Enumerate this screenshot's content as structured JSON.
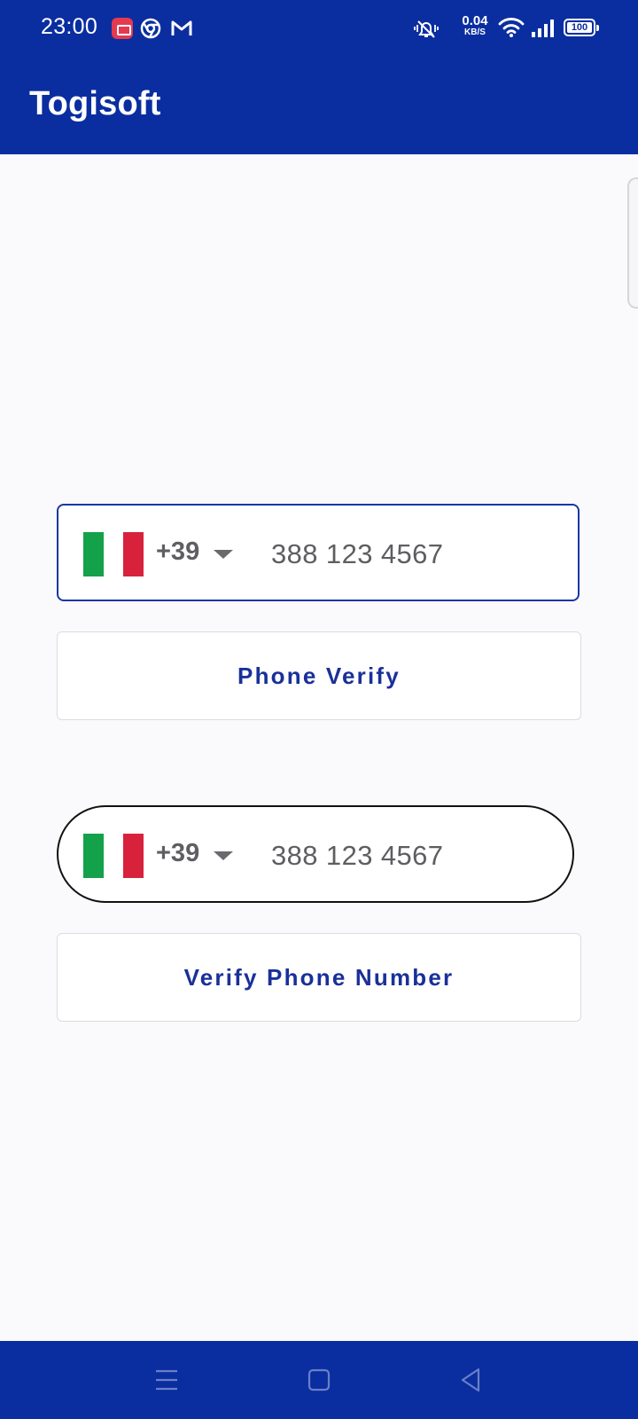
{
  "status_bar": {
    "time": "23:00",
    "net_speed_value": "0.04",
    "net_speed_unit": "KB/S",
    "battery": "100",
    "icons": [
      "screen-record-icon",
      "chrome-icon",
      "gmail-icon",
      "mute-icon",
      "wifi-icon",
      "signal-icon",
      "battery-icon"
    ]
  },
  "app_bar": {
    "title": "Togisoft"
  },
  "phone_input_1": {
    "country_flag": "italy-flag-icon",
    "dial_code": "+39",
    "placeholder": "388 123 4567",
    "value": ""
  },
  "button_1": {
    "label": "Phone Verify"
  },
  "phone_input_2": {
    "country_flag": "italy-flag-icon",
    "dial_code": "+39",
    "placeholder": "388 123 4567",
    "value": ""
  },
  "button_2": {
    "label": "Verify Phone Number"
  },
  "nav_bar": {
    "buttons": [
      "menu-icon",
      "home-icon",
      "back-icon"
    ]
  },
  "colors": {
    "primary": "#0a2ea0",
    "button_text": "#1a3099",
    "background": "#fafafc",
    "flag_green": "#13a14a",
    "flag_red": "#d8223b"
  }
}
